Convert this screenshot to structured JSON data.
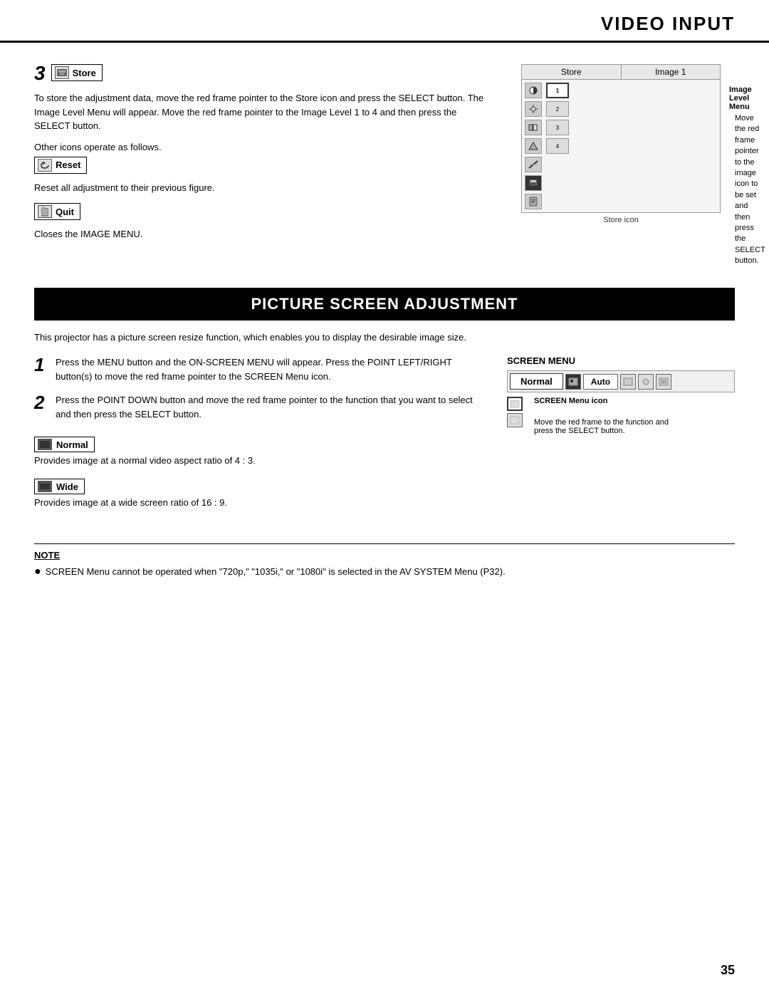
{
  "header": {
    "title": "VIDEO INPUT"
  },
  "store_section": {
    "step_number": "3",
    "store_label": "Store",
    "store_description": "To store the adjustment data, move the red frame pointer to the Store icon and press the SELECT button.  The Image Level Menu will appear.  Move the red frame pointer to the Image Level 1 to 4 and then press the SELECT button.",
    "other_icons_text": "Other icons operate as follows.",
    "reset_label": "Reset",
    "reset_description": "Reset all adjustment to their previous figure.",
    "quit_label": "Quit",
    "quit_description": "Closes the IMAGE MENU.",
    "menu_diagram": {
      "col1": "Store",
      "col2": "Image 1",
      "image_level_menu_text": "Image Level Menu",
      "annotation_line1": "Move the red frame pointer",
      "annotation_line2": "to the image icon to be set",
      "annotation_line3": "and then press the SELECT",
      "annotation_line4": "button.",
      "store_icon_label": "Store icon"
    }
  },
  "psa_section": {
    "title": "PICTURE SCREEN ADJUSTMENT",
    "intro": "This projector has a picture screen resize function, which enables you to display the desirable image size.",
    "step1_number": "1",
    "step1_text": "Press the MENU button and the ON-SCREEN MENU will appear.  Press the POINT LEFT/RIGHT button(s) to move the red frame pointer to the SCREEN Menu icon.",
    "step2_number": "2",
    "step2_text": "Press the POINT DOWN button and move the red frame pointer to the function that you want to select and then press the SELECT button.",
    "screen_menu_label": "SCREEN MENU",
    "screen_menu_normal": "Normal",
    "screen_menu_auto": "Auto",
    "screen_menu_icon_label": "SCREEN Menu icon",
    "screen_menu_annotation_line1": "Move the red frame to the function and",
    "screen_menu_annotation_line2": "press the SELECT button.",
    "normal_label": "Normal",
    "normal_desc": "Provides image at a normal video aspect ratio of 4 : 3.",
    "wide_label": "Wide",
    "wide_desc": "Provides image at a wide screen ratio of 16 : 9."
  },
  "note_section": {
    "title": "NOTE",
    "bullet": "●",
    "text": "SCREEN Menu cannot be operated when \"720p,\" \"1035i,\" or \"1080i\" is selected in the AV SYSTEM Menu (P32)."
  },
  "page_number": "35"
}
